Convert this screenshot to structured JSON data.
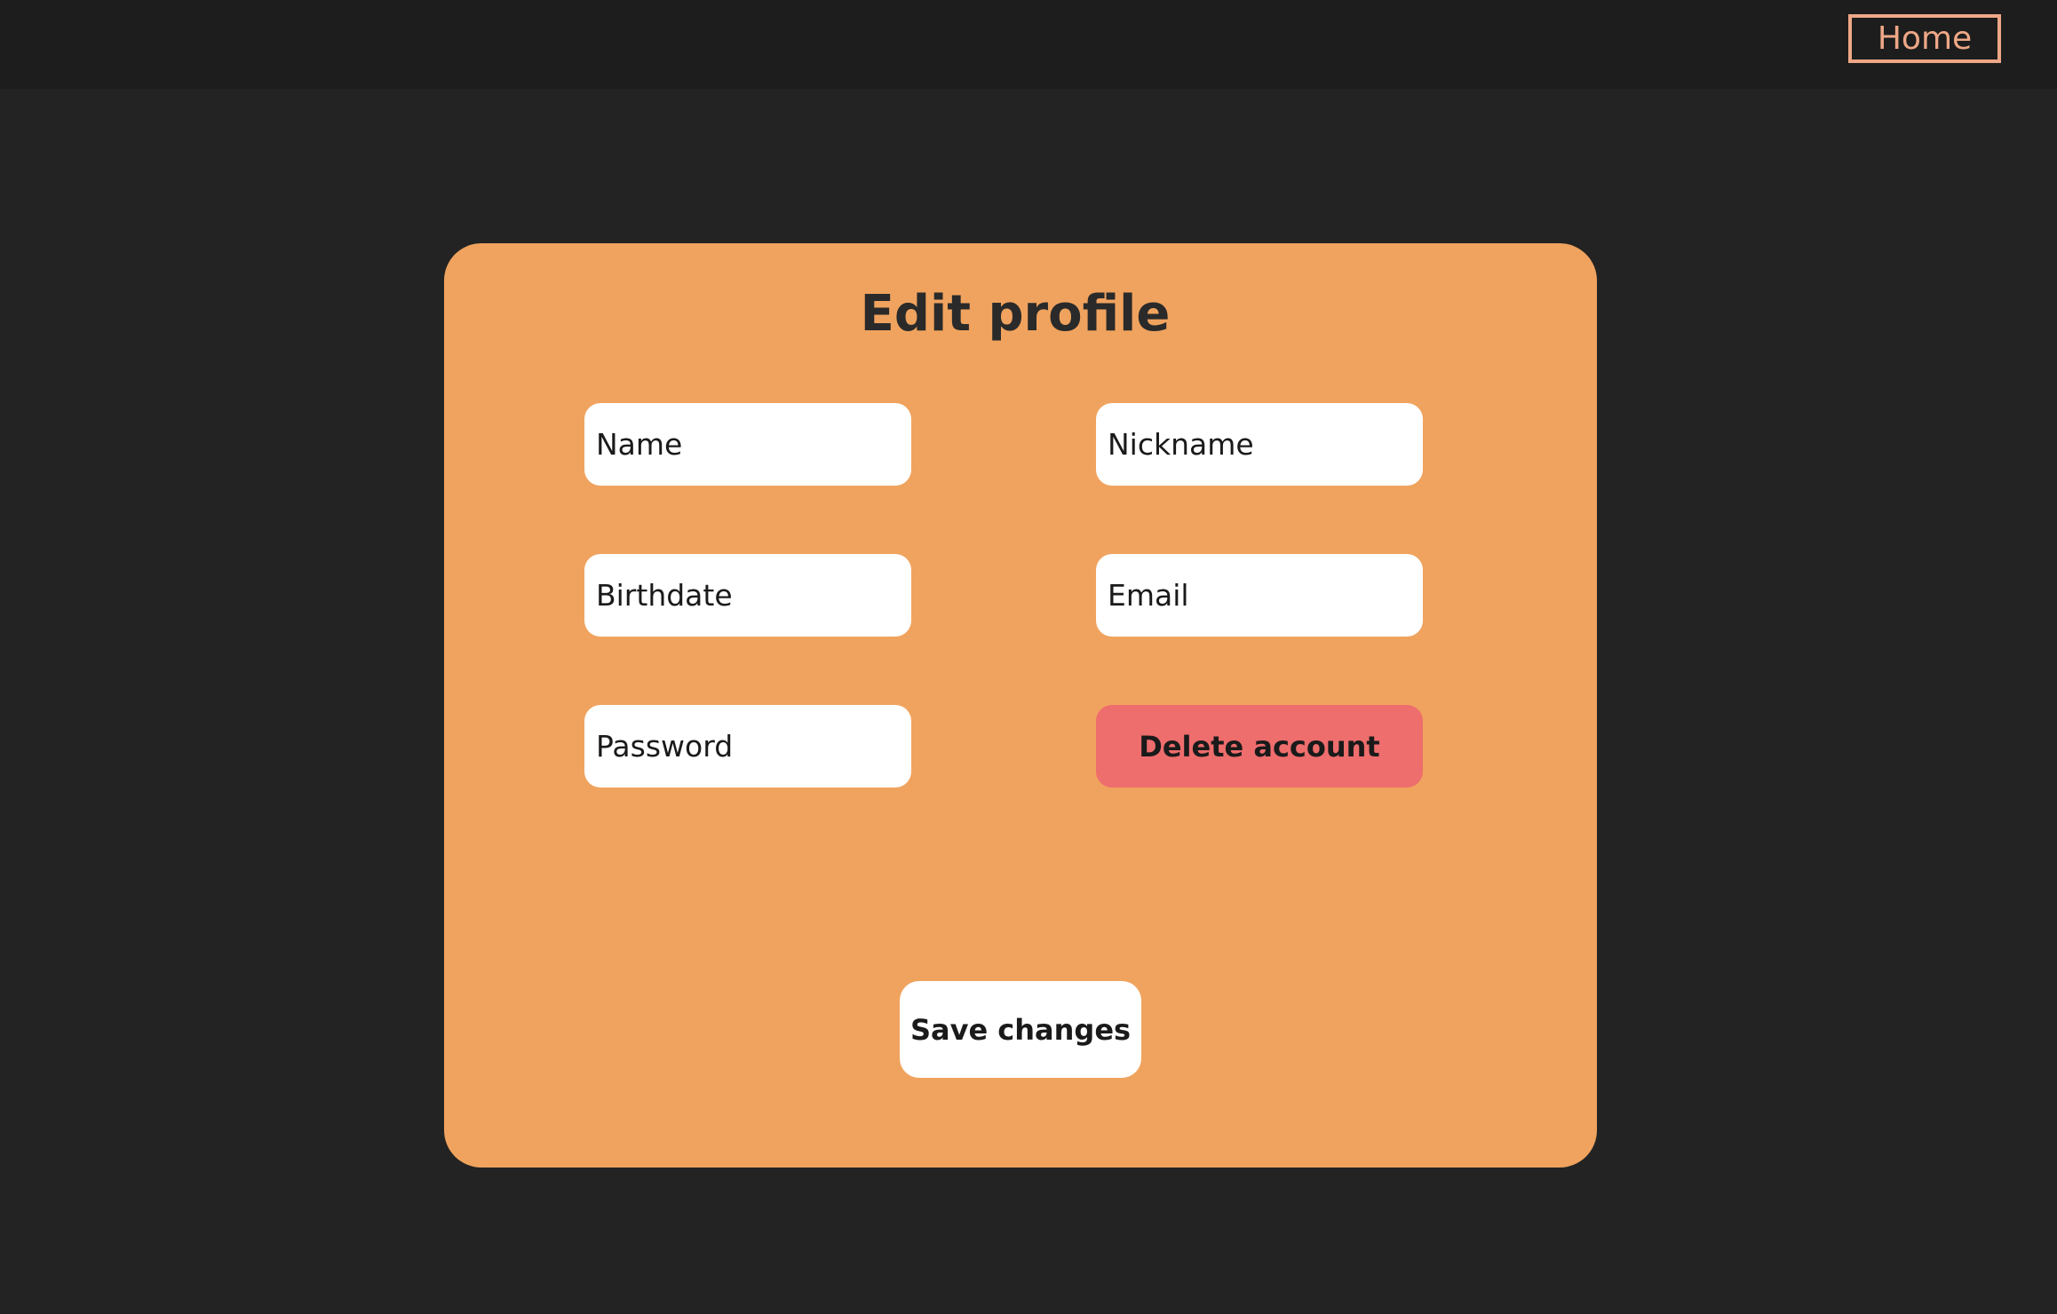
{
  "header": {
    "home_label": "Home"
  },
  "form": {
    "title": "Edit profile",
    "fields": {
      "name": {
        "placeholder": "Name",
        "value": ""
      },
      "nickname": {
        "placeholder": "Nickname",
        "value": ""
      },
      "birthdate": {
        "placeholder": "Birthdate",
        "value": ""
      },
      "email": {
        "placeholder": "Email",
        "value": ""
      },
      "password": {
        "placeholder": "Password",
        "value": ""
      }
    },
    "delete_label": "Delete account",
    "save_label": "Save changes"
  },
  "colors": {
    "page_background": "#232323",
    "topbar_background": "#1d1d1d",
    "accent_home": "#eea786",
    "card_background": "#f0a35e",
    "delete_button": "#ee6d6d",
    "field_background": "#ffffff"
  }
}
